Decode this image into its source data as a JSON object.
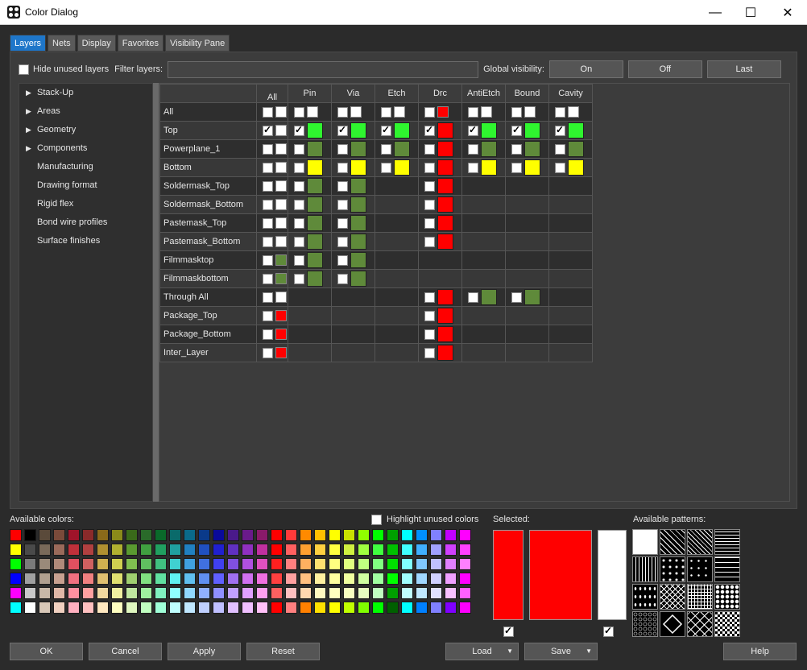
{
  "window": {
    "title": "Color Dialog"
  },
  "tabs": [
    "Layers",
    "Nets",
    "Display",
    "Favorites",
    "Visibility Pane"
  ],
  "topbar": {
    "hide_unused_label": "Hide unused layers",
    "filter_label": "Filter layers:",
    "filter_value": "",
    "global_visibility_label": "Global visibility:",
    "btn_on": "On",
    "btn_off": "Off",
    "btn_last": "Last"
  },
  "tree": [
    {
      "label": "Stack-Up",
      "expandable": true
    },
    {
      "label": "Areas",
      "expandable": true
    },
    {
      "label": "Geometry",
      "expandable": true
    },
    {
      "label": "Components",
      "expandable": true
    },
    {
      "label": "Manufacturing",
      "expandable": false
    },
    {
      "label": "Drawing format",
      "expandable": false
    },
    {
      "label": "Rigid flex",
      "expandable": false
    },
    {
      "label": "Bond wire profiles",
      "expandable": false
    },
    {
      "label": "Surface finishes",
      "expandable": false
    }
  ],
  "grid": {
    "columns": [
      "All",
      "Pin",
      "Via",
      "Etch",
      "Drc",
      "AntiEtch",
      "Bound",
      "Cavity"
    ],
    "header_row_label": "All",
    "rows": [
      {
        "name": "Top",
        "all": [
          "check",
          "white"
        ],
        "cells": [
          "cg",
          "cg",
          "cg",
          "cr",
          "cg",
          "cg",
          "cg"
        ]
      },
      {
        "name": "Powerplane_1",
        "all": [
          "box",
          "white"
        ],
        "cells": [
          "o",
          "o",
          "o",
          "r",
          "o",
          "o",
          "o"
        ]
      },
      {
        "name": "Bottom",
        "all": [
          "box",
          "white"
        ],
        "cells": [
          "y",
          "y",
          "y",
          "r",
          "y",
          "y",
          "y"
        ]
      },
      {
        "name": "Soldermask_Top",
        "all": [
          "box",
          "white"
        ],
        "cells": [
          "o",
          "o",
          "-",
          "r",
          "-",
          "-",
          "-"
        ]
      },
      {
        "name": "Soldermask_Bottom",
        "all": [
          "box",
          "white"
        ],
        "cells": [
          "o",
          "o",
          "-",
          "r",
          "-",
          "-",
          "-"
        ]
      },
      {
        "name": "Pastemask_Top",
        "all": [
          "box",
          "white"
        ],
        "cells": [
          "o",
          "o",
          "-",
          "r",
          "-",
          "-",
          "-"
        ]
      },
      {
        "name": "Pastemask_Bottom",
        "all": [
          "box",
          "white"
        ],
        "cells": [
          "o",
          "o",
          "-",
          "r",
          "-",
          "-",
          "-"
        ]
      },
      {
        "name": "Filmmasktop",
        "all": [
          "box",
          "olive"
        ],
        "cells": [
          "o",
          "o",
          "-",
          "-",
          "-",
          "-",
          "-"
        ]
      },
      {
        "name": "Filmmaskbottom",
        "all": [
          "box",
          "olive"
        ],
        "cells": [
          "o",
          "o",
          "-",
          "-",
          "-",
          "-",
          "-"
        ]
      },
      {
        "name": "Through All",
        "all": [
          "box",
          "white"
        ],
        "cells": [
          "-",
          "-",
          "-",
          "r",
          "o",
          "o",
          "-"
        ]
      },
      {
        "name": "Package_Top",
        "all": [
          "box",
          "red"
        ],
        "cells": [
          "-",
          "-",
          "-",
          "r",
          "-",
          "-",
          "-"
        ]
      },
      {
        "name": "Package_Bottom",
        "all": [
          "box",
          "red"
        ],
        "cells": [
          "-",
          "-",
          "-",
          "r",
          "-",
          "-",
          "-"
        ]
      },
      {
        "name": "Inter_Layer",
        "all": [
          "box",
          "red"
        ],
        "cells": [
          "-",
          "-",
          "-",
          "r",
          "-",
          "-",
          "-"
        ]
      }
    ]
  },
  "colors": {
    "green": "#2ff52f",
    "olive": "#5f8a3a",
    "yellow": "#ffff00",
    "red": "#ff0000",
    "white": "#ffffff"
  },
  "bottom": {
    "available_colors_label": "Available colors:",
    "highlight_unused_label": "Highlight unused colors",
    "selected_label": "Selected:",
    "available_patterns_label": "Available patterns:"
  },
  "palette": [
    [
      "#ff0000",
      "#000000",
      "#5a4a3a",
      "#7a4a3a",
      "#a0142a",
      "#8a2a2a",
      "#8a6a1a",
      "#8a8a1a",
      "#3a6a1a",
      "#2a6a2a",
      "#0a6a2a",
      "#0a6a6a",
      "#0a6a8a",
      "#0a3a8a",
      "#0a0a9a",
      "#4a1a8a",
      "#6a1a8a",
      "#8a1a6a",
      "#ff0000",
      "#ff3a3a",
      "#ff8a00",
      "#ffc000",
      "#ffff00",
      "#c8e000",
      "#90ff00",
      "#00ff00",
      "#00a000",
      "#00ffff",
      "#0090ff",
      "#8080ff",
      "#c000ff",
      "#ff00ff"
    ],
    [
      "#ffff00",
      "#4a4a4a",
      "#7a6a5a",
      "#9a6a5a",
      "#c0303a",
      "#b04040",
      "#b09030",
      "#b0b030",
      "#5a9a30",
      "#40a040",
      "#20a060",
      "#20a0a0",
      "#2080c0",
      "#2050c0",
      "#2020d0",
      "#6030c0",
      "#9030c0",
      "#c030a0",
      "#ff0000",
      "#ff6060",
      "#ffa030",
      "#ffd040",
      "#ffff40",
      "#d0f040",
      "#a0ff40",
      "#40ff40",
      "#00c000",
      "#40ffff",
      "#40b0ff",
      "#a0a0ff",
      "#d040ff",
      "#ff40ff"
    ],
    [
      "#00ff00",
      "#7a7a7a",
      "#9a8a7a",
      "#b08a7a",
      "#e05060",
      "#d06060",
      "#d0b050",
      "#d0d050",
      "#80c050",
      "#60c060",
      "#40c080",
      "#40d0d0",
      "#40a0e0",
      "#4070e0",
      "#4040f0",
      "#8050e0",
      "#b050e0",
      "#e050c0",
      "#ff2020",
      "#ff8080",
      "#ffb060",
      "#ffe070",
      "#ffff80",
      "#e0ff80",
      "#c0ff80",
      "#80ff80",
      "#00e000",
      "#80ffff",
      "#80c8ff",
      "#c0c0ff",
      "#e080ff",
      "#ff80ff"
    ],
    [
      "#0000ff",
      "#a0a0a0",
      "#b0a090",
      "#c8a090",
      "#f07080",
      "#f08080",
      "#e0c070",
      "#e0e070",
      "#a0d070",
      "#80e080",
      "#60e0a0",
      "#60f0f0",
      "#60c0f0",
      "#6090f0",
      "#6060ff",
      "#a070f0",
      "#d070f0",
      "#f070e0",
      "#ff4040",
      "#ffa0a0",
      "#ffc080",
      "#fff0a0",
      "#ffffa0",
      "#f0ffa0",
      "#d0ffa0",
      "#a0ffa0",
      "#00ff00",
      "#a0ffff",
      "#a0d8ff",
      "#d0d0ff",
      "#f0a0ff",
      "#ff00ff"
    ],
    [
      "#ff00ff",
      "#c8c8c8",
      "#c8b8a8",
      "#e0b8a8",
      "#ff90a0",
      "#ffa0a0",
      "#f0d8a0",
      "#f0f0a0",
      "#c0e8a0",
      "#a0f0a0",
      "#80f0c0",
      "#90ffff",
      "#90d8ff",
      "#90b0ff",
      "#9090ff",
      "#c0a0ff",
      "#e0a0ff",
      "#ffa0f0",
      "#ff6060",
      "#ffc0c0",
      "#ffd8b0",
      "#fff8c0",
      "#ffffc0",
      "#f8ffc0",
      "#e8ffc0",
      "#c0ffc0",
      "#00a000",
      "#c0ffff",
      "#c0e8ff",
      "#e0e0ff",
      "#f8c0ff",
      "#ff60ff"
    ],
    [
      "#00ffff",
      "#ffffff",
      "#d8c8b8",
      "#f0d0c0",
      "#ffb0c0",
      "#ffc0c0",
      "#ffe8c0",
      "#ffffc0",
      "#e0f8c0",
      "#c0ffc0",
      "#a0ffd8",
      "#c0ffff",
      "#c0e8ff",
      "#c0d0ff",
      "#c0c0ff",
      "#e0c0ff",
      "#f0c0ff",
      "#ffc0f8",
      "#ff0000",
      "#ff8080",
      "#ff8000",
      "#ffe000",
      "#ffff00",
      "#c0ff00",
      "#80ff00",
      "#00ff00",
      "#006000",
      "#00ffff",
      "#0080ff",
      "#8080ff",
      "#8000ff",
      "#ff00ff"
    ]
  ],
  "patterns": [
    "solid-white",
    "diag-fwd",
    "diag-fwd-dense",
    "horiz-lines",
    "vert-lines",
    "triangles",
    "crosses",
    "dashes",
    "dots-sparse",
    "diag-crosshatch",
    "grid",
    "dots-dense",
    "circles",
    "diamond-outline",
    "x-crosshatch",
    "checker-diamond"
  ],
  "buttons": {
    "ok": "OK",
    "cancel": "Cancel",
    "apply": "Apply",
    "reset": "Reset",
    "load": "Load",
    "save": "Save",
    "help": "Help"
  }
}
